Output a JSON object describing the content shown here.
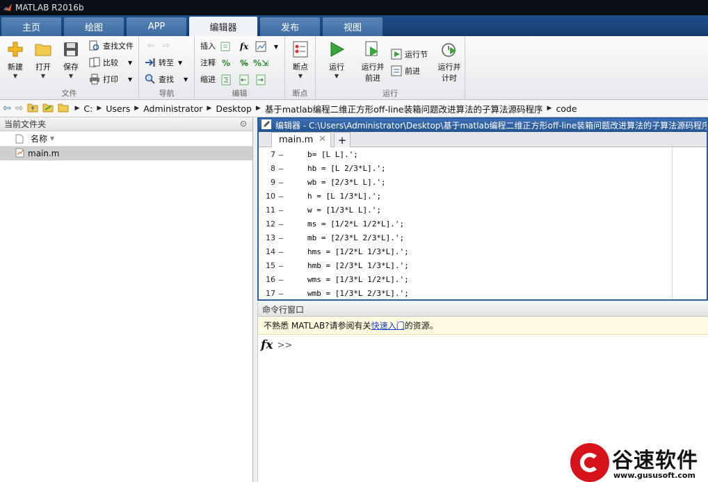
{
  "window": {
    "title": "MATLAB R2016b"
  },
  "tabs": [
    "主页",
    "绘图",
    "APP",
    "编辑器",
    "发布",
    "视图"
  ],
  "ribbon": {
    "file": {
      "new": "新建",
      "open": "打开",
      "save": "保存",
      "find_files": "查找文件",
      "compare": "比较",
      "print": "打印",
      "label": "文件"
    },
    "navigate": {
      "goto": "转至",
      "find": "查找",
      "label": "导航"
    },
    "edit": {
      "insert": "插入",
      "comment": "注释",
      "indent": "缩进",
      "label": "编辑"
    },
    "breakpoints": {
      "btn": "断点",
      "label": "断点"
    },
    "run": {
      "run": "运行",
      "run_advance_1": "运行并",
      "run_advance_2": "前进",
      "run_section": "运行节",
      "advance": "前进",
      "run_time_1": "运行并",
      "run_time_2": "计时",
      "label": "运行"
    }
  },
  "address": [
    "C:",
    "Users",
    "Administrator",
    "Desktop",
    "基于matlab编程二维正方形off-line装箱问题改进算法的子算法源码程序",
    "code"
  ],
  "left_pane": {
    "title": "当前文件夹",
    "col_name": "名称",
    "files": [
      "main.m"
    ]
  },
  "editor": {
    "title": "编辑器 - C:\\Users\\Administrator\\Desktop\\基于matlab编程二维正方形off-line装箱问题改进算法的子算法源码程序\\",
    "tab": "main.m",
    "lines": [
      {
        "n": "7",
        "code": "b= [L L].';"
      },
      {
        "n": "8",
        "code": "hb = [L 2/3*L].';"
      },
      {
        "n": "9",
        "code": "wb = [2/3*L L].';"
      },
      {
        "n": "10",
        "code": "h = [L 1/3*L].';"
      },
      {
        "n": "11",
        "code": "w = [1/3*L L].';"
      },
      {
        "n": "12",
        "code": "ms = [1/2*L 1/2*L].';"
      },
      {
        "n": "13",
        "code": "mb = [2/3*L 2/3*L].';"
      },
      {
        "n": "14",
        "code": "hms = [1/2*L 1/3*L].';"
      },
      {
        "n": "15",
        "code": "hmb = [2/3*L 1/3*L].';"
      },
      {
        "n": "16",
        "code": "wms = [1/3*L 1/2*L].';"
      },
      {
        "n": "17",
        "code": "wmb = [1/3*L 2/3*L].';"
      }
    ]
  },
  "command_window": {
    "title": "命令行窗口",
    "notice_before": "不熟悉 MATLAB?请参阅有关",
    "notice_link": "快速入门",
    "notice_after": "的资源。",
    "prompt": ">>"
  },
  "watermark": {
    "name": "谷速软件",
    "url": "www.gususoft.com"
  }
}
